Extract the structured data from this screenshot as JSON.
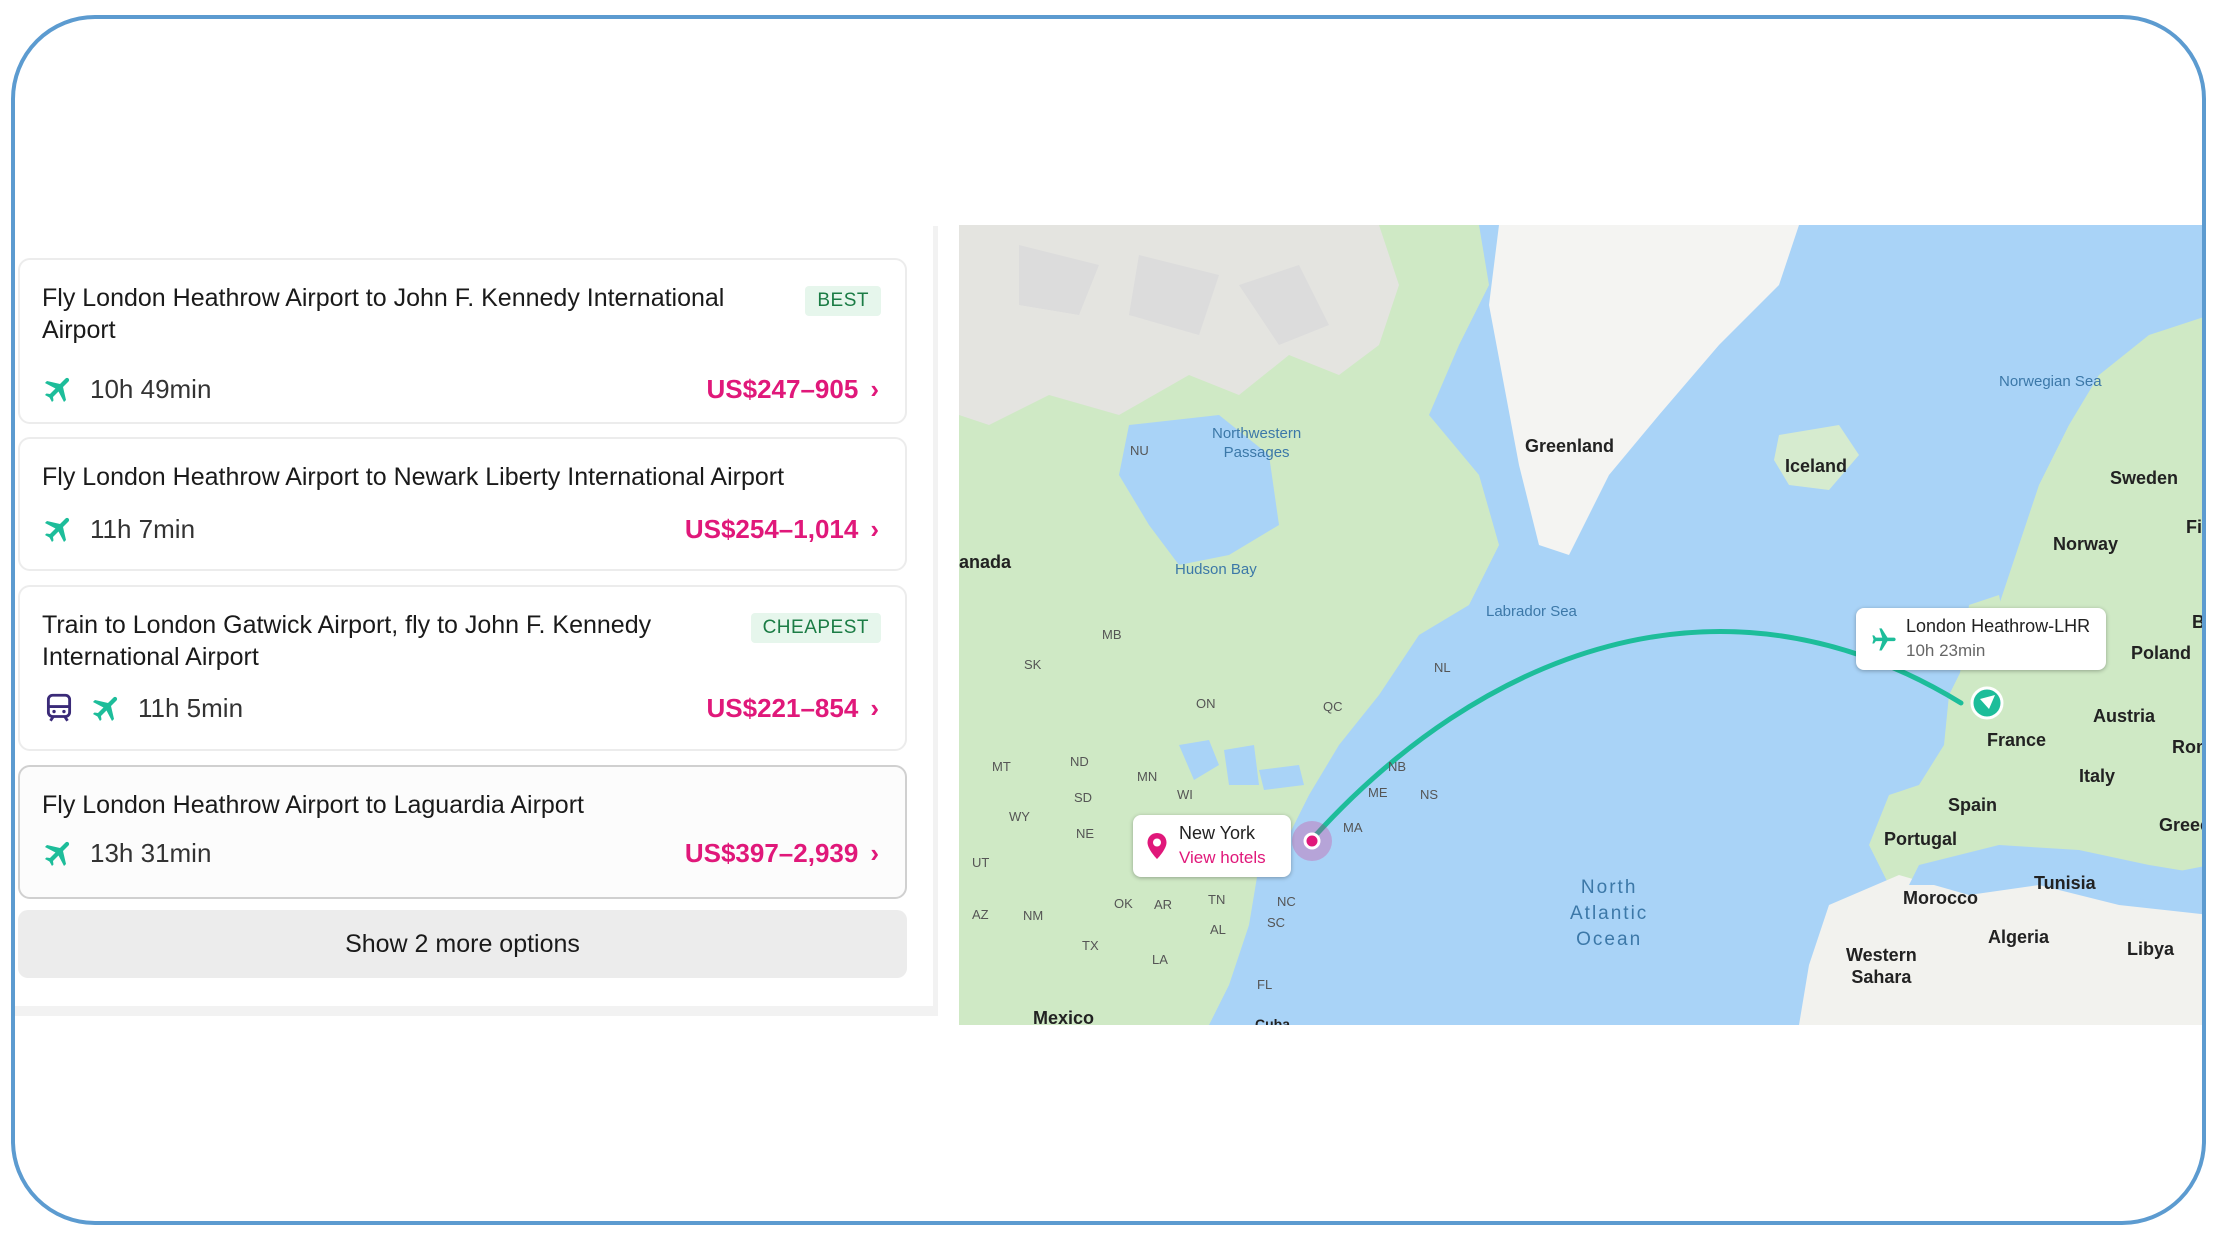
{
  "routes": [
    {
      "title": "Fly London Heathrow Airport to John F. Kennedy International Airport",
      "badge": "BEST",
      "duration": "10h 49min",
      "price": "US$247–905",
      "modes": [
        "plane-icon"
      ]
    },
    {
      "title": "Fly London Heathrow Airport to Newark Liberty International Airport",
      "badge": "",
      "duration": "11h 7min",
      "price": "US$254–1,014",
      "modes": [
        "plane-icon"
      ]
    },
    {
      "title": "Train to London Gatwick Airport, fly to John F. Kennedy International Airport",
      "badge": "CHEAPEST",
      "duration": "11h 5min",
      "price": "US$221–854",
      "modes": [
        "train-icon",
        "plane-icon"
      ]
    },
    {
      "title": "Fly London Heathrow Airport to Laguardia Airport",
      "badge": "",
      "duration": "13h 31min",
      "price": "US$397–2,939",
      "modes": [
        "plane-icon"
      ]
    }
  ],
  "more_options_label": "Show 2 more options",
  "colors": {
    "accent": "#e0187a",
    "route_line": "#1dbd9a",
    "badge_bg": "#e6f6ec",
    "badge_text": "#1b7c45"
  },
  "map": {
    "origin": {
      "name": "London Heathrow-LHR",
      "duration": "10h 23min"
    },
    "destination": {
      "name": "New York",
      "link": "View hotels"
    },
    "labels": {
      "greenland": "Greenland",
      "iceland": "Iceland",
      "sweden": "Sweden",
      "norway": "Norway",
      "fin": "Fin",
      "poland": "Poland",
      "france": "France",
      "austria": "Austria",
      "roma": "Roma",
      "italy": "Italy",
      "spain": "Spain",
      "portugal": "Portugal",
      "greece": "Greece",
      "tunisia": "Tunisia",
      "morocco": "Morocco",
      "algeria": "Algeria",
      "libya": "Libya",
      "western_sahara": "Western\nSahara",
      "b": "B",
      "canada": "anada",
      "mexico": "Mexico",
      "cuba": "Cuba",
      "hudson_bay": "Hudson Bay",
      "labrador_sea": "Labrador Sea",
      "norwegian_sea": "Norwegian Sea",
      "nw_passages": "Northwestern\nPassages",
      "north_atlantic": "North\nAtlantic\nOcean",
      "states": [
        "NU",
        "MB",
        "SK",
        "ON",
        "QC",
        "NL",
        "NB",
        "NS",
        "MT",
        "ND",
        "MN",
        "WI",
        "SD",
        "WY",
        "NE",
        "UT",
        "ME",
        "AZ",
        "NM",
        "OK",
        "AR",
        "TN",
        "NC",
        "AL",
        "SC",
        "TX",
        "LA",
        "FL",
        "MA"
      ]
    }
  }
}
